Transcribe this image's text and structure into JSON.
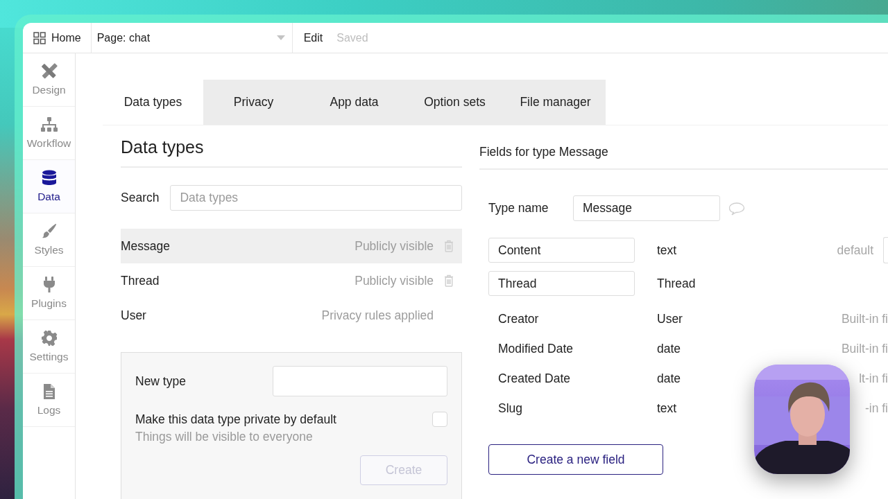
{
  "topbar": {
    "home": "Home",
    "page": "Page: chat",
    "edit": "Edit",
    "status": "Saved"
  },
  "sidebar": {
    "items": [
      {
        "label": "Design",
        "kind": "design",
        "selected": false
      },
      {
        "label": "Workflow",
        "kind": "workflow",
        "selected": false
      },
      {
        "label": "Data",
        "kind": "data",
        "selected": true
      },
      {
        "label": "Styles",
        "kind": "styles",
        "selected": false
      },
      {
        "label": "Plugins",
        "kind": "plugins",
        "selected": false
      },
      {
        "label": "Settings",
        "kind": "settings",
        "selected": false
      },
      {
        "label": "Logs",
        "kind": "logs",
        "selected": false
      }
    ]
  },
  "tabs": [
    {
      "label": "Data types",
      "selected": true
    },
    {
      "label": "Privacy",
      "selected": false
    },
    {
      "label": "App data",
      "selected": false
    },
    {
      "label": "Option sets",
      "selected": false
    },
    {
      "label": "File manager",
      "selected": false
    }
  ],
  "data_types": {
    "title": "Data types",
    "search_label": "Search",
    "search_placeholder": "Data types",
    "types": [
      {
        "name": "Message",
        "privacy": "Publicly visible",
        "deletable": true,
        "selected": true
      },
      {
        "name": "Thread",
        "privacy": "Publicly visible",
        "deletable": true,
        "selected": false
      },
      {
        "name": "User",
        "privacy": "Privacy rules applied",
        "deletable": false,
        "selected": false
      }
    ],
    "new_type": {
      "label": "New type",
      "private_label": "Make this data type private by default",
      "private_checked": false,
      "hint": "Things will be visible to everyone",
      "button": "Create",
      "button_disabled": true
    }
  },
  "fields": {
    "title": "Fields for type Message",
    "type_name_label": "Type name",
    "type_name": "Message",
    "rows": [
      {
        "name": "Content",
        "type": "text",
        "kind": "editable",
        "note": "default"
      },
      {
        "name": "Thread",
        "type": "Thread",
        "kind": "editable"
      },
      {
        "name": "Creator",
        "type": "User",
        "kind": "builtin",
        "note": "Built-in fi"
      },
      {
        "name": "Modified Date",
        "type": "date",
        "kind": "builtin",
        "note": "Built-in fi"
      },
      {
        "name": "Created Date",
        "type": "date",
        "kind": "builtin",
        "note": "lt-in fi"
      },
      {
        "name": "Slug",
        "type": "text",
        "kind": "builtin",
        "note": "-in fi"
      }
    ],
    "button": "Create a new field"
  }
}
